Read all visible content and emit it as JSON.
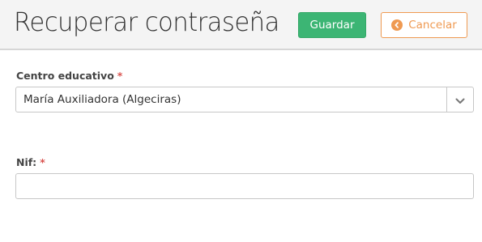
{
  "header": {
    "title": "Recuperar contraseña",
    "save_label": "Guardar",
    "cancel_label": "Cancelar"
  },
  "form": {
    "centro": {
      "label": "Centro educativo",
      "required_mark": "*",
      "selected_value": "María Auxiliadora (Algeciras)"
    },
    "nif": {
      "label": "Nif:",
      "required_mark": "*",
      "value": ""
    }
  },
  "colors": {
    "save": "#3cb574",
    "cancel": "#ef9a52",
    "required": "#d9534f"
  },
  "icons": {
    "cancel": "circle-chevron-left-icon",
    "dropdown": "chevron-down-icon"
  }
}
